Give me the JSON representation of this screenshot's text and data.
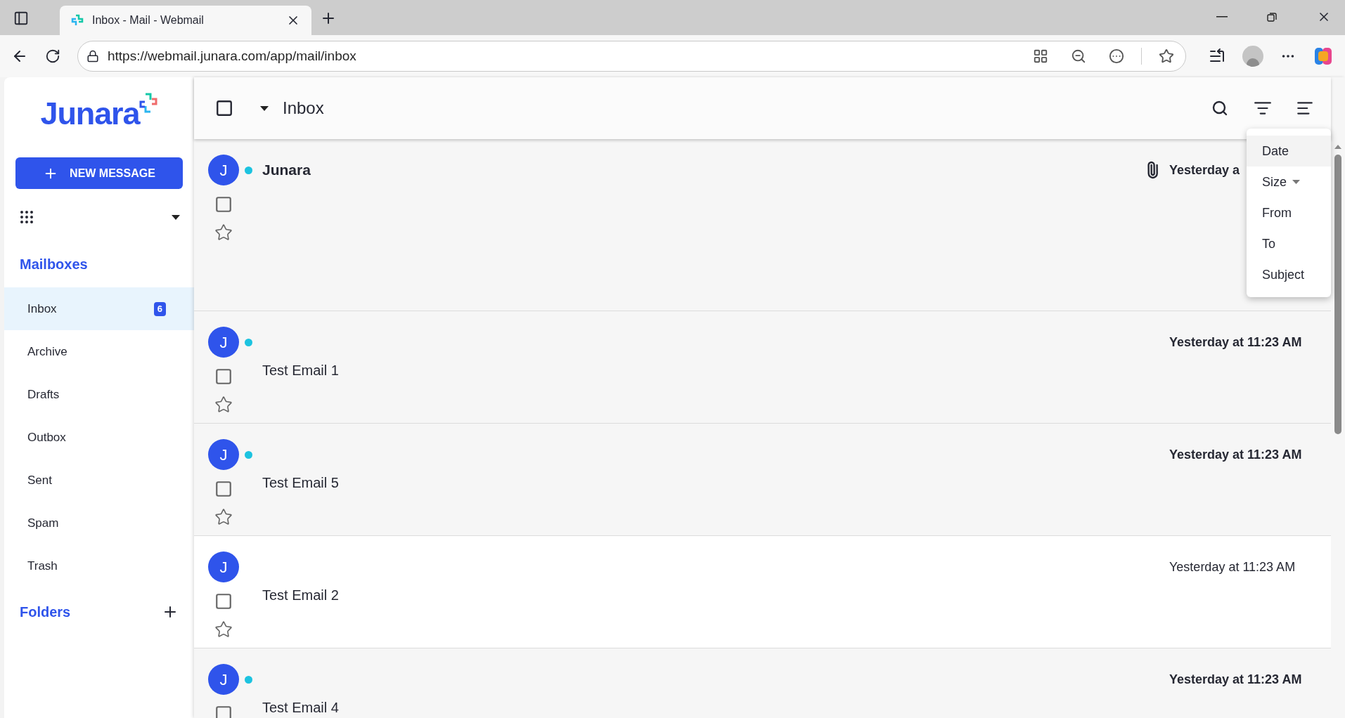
{
  "browser": {
    "tab": {
      "title": "Inbox - Mail - Webmail"
    },
    "url": "https://webmail.junara.com/app/mail/inbox"
  },
  "sidebar": {
    "logo": "Junara",
    "new_message": "NEW MESSAGE",
    "mailboxes_heading": "Mailboxes",
    "mailboxes": [
      {
        "label": "Inbox",
        "badge": "6",
        "selected": true
      },
      {
        "label": "Archive",
        "selected": false
      },
      {
        "label": "Drafts",
        "selected": false
      },
      {
        "label": "Outbox",
        "selected": false
      },
      {
        "label": "Sent",
        "selected": false
      },
      {
        "label": "Spam",
        "selected": false
      },
      {
        "label": "Trash",
        "selected": false
      }
    ],
    "folders_heading": "Folders"
  },
  "list": {
    "select_all": {
      "checked": false
    },
    "title": "Inbox",
    "messages": [
      {
        "avatar": "J",
        "sender": "Junara",
        "time": "Yesterday a",
        "unread": true,
        "attachment": true,
        "checked": false,
        "starred": false
      },
      {
        "avatar": "J",
        "subject": "Test Email 1",
        "time": "Yesterday at 11:23 AM",
        "unread": true,
        "attachment": false,
        "checked": false,
        "starred": false
      },
      {
        "avatar": "J",
        "subject": "Test Email 5",
        "time": "Yesterday at 11:23 AM",
        "unread": true,
        "attachment": false,
        "checked": false,
        "starred": false
      },
      {
        "avatar": "J",
        "subject": "Test Email 2",
        "time": "Yesterday at 11:23 AM",
        "unread": false,
        "attachment": false,
        "checked": false,
        "starred": false
      },
      {
        "avatar": "J",
        "subject": "Test Email 4",
        "time": "Yesterday at 11:23 AM",
        "unread": true,
        "attachment": false,
        "checked": false
      }
    ]
  },
  "sort_menu": {
    "items": [
      {
        "label": "Date",
        "selected": true,
        "caret": false
      },
      {
        "label": "Size",
        "selected": false,
        "caret": true
      },
      {
        "label": "From",
        "selected": false,
        "caret": false
      },
      {
        "label": "To",
        "selected": false,
        "caret": false
      },
      {
        "label": "Subject",
        "selected": false,
        "caret": false
      }
    ]
  }
}
